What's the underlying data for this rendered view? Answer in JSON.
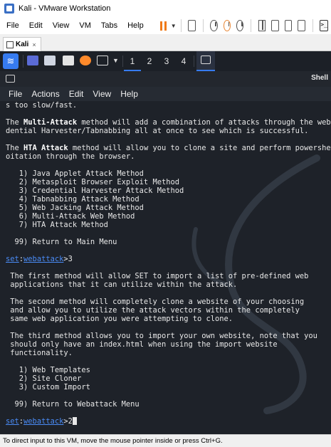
{
  "window": {
    "title": "Kali - VMware Workstation"
  },
  "menu": [
    "File",
    "Edit",
    "View",
    "VM",
    "Tabs",
    "Help"
  ],
  "toolbar": {
    "accent": "#f07a17"
  },
  "vm_tab": {
    "label": "Kali",
    "close": "×"
  },
  "kali_panel": {
    "workspaces": [
      "1",
      "2",
      "3",
      "4"
    ],
    "active_workspace": 1,
    "accent": "#367bf0"
  },
  "terminal": {
    "title": "Shell",
    "menu": [
      "File",
      "Actions",
      "Edit",
      "View",
      "Help"
    ],
    "lines": [
      "s too slow/fast.",
      "",
      "The |Multi-Attack| method will add a combination of attacks through the web att",
      "dential Harvester/Tabnabbing all at once to see which is successful.",
      "",
      "The |HTA Attack| method will allow you to clone a site and perform powershell i",
      "oitation through the browser.",
      "",
      "   1) Java Applet Attack Method",
      "   2) Metasploit Browser Exploit Method",
      "   3) Credential Harvester Attack Method",
      "   4) Tabnabbing Attack Method",
      "   5) Web Jacking Attack Method",
      "   6) Multi-Attack Web Method",
      "   7) HTA Attack Method",
      "",
      "  99) Return to Main Menu",
      "",
      "#PROMPT#>3",
      "",
      " The first method will allow SET to import a list of pre-defined web",
      " applications that it can utilize within the attack.",
      "",
      " The second method will completely clone a website of your choosing",
      " and allow you to utilize the attack vectors within the completely",
      " same web application you were attempting to clone.",
      "",
      " The third method allows you to import your own website, note that you",
      " should only have an index.html when using the import website",
      " functionality.",
      "",
      "   1) Web Templates",
      "   2) Site Cloner",
      "   3) Custom Import",
      "",
      "  99) Return to Webattack Menu",
      "",
      "#PROMPT#>2#CURSOR#"
    ],
    "prompt": {
      "set": "set",
      "ctx": "webattack",
      "sep": ":"
    }
  },
  "status_bar": {
    "text": "To direct input to this VM, move the mouse pointer inside or press Ctrl+G."
  }
}
